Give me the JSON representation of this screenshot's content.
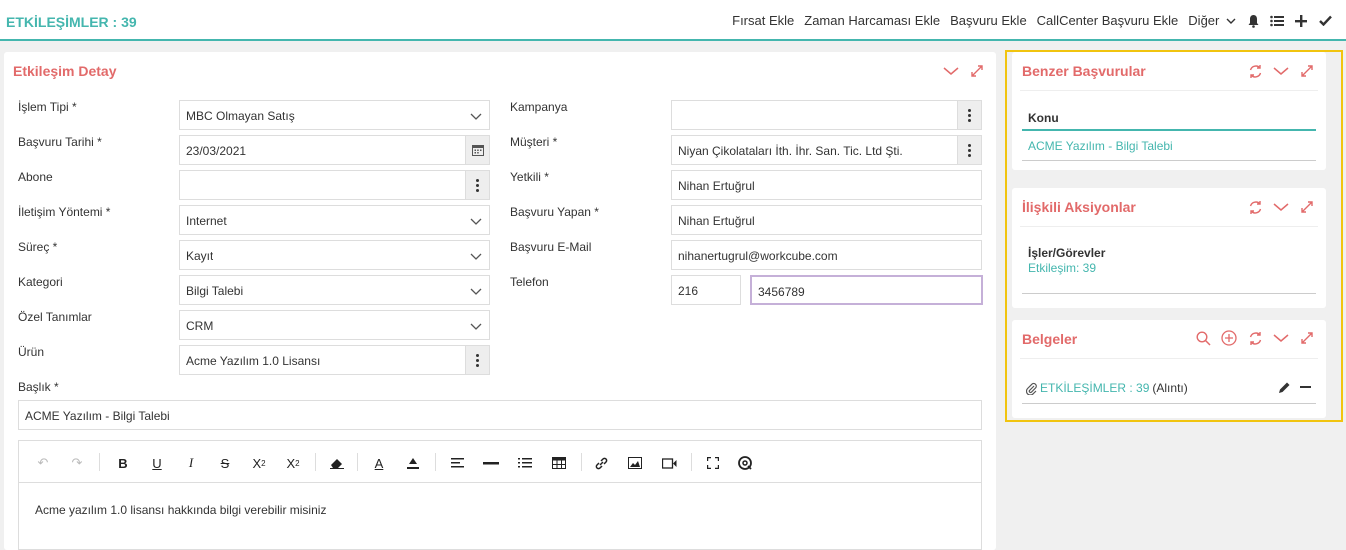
{
  "header": {
    "title": "ETKİLEŞİMLER : 39",
    "actions": [
      "Fırsat Ekle",
      "Zaman Harcaması Ekle",
      "Başvuru Ekle",
      "CallCenter Başvuru Ekle",
      "Diğer"
    ]
  },
  "main": {
    "title": "Etkileşim Detay",
    "labels": {
      "islem_tipi": "İşlem Tipi *",
      "basvuru_tarihi": "Başvuru Tarihi *",
      "abone": "Abone",
      "iletisim_yontemi": "İletişim Yöntemi *",
      "surec": "Süreç *",
      "kategori": "Kategori",
      "ozel_tanimlar": "Özel Tanımlar",
      "urun": "Ürün",
      "baslik": "Başlık *",
      "kampanya": "Kampanya",
      "musteri": "Müşteri *",
      "yetkili": "Yetkili *",
      "basvuru_yapan": "Başvuru Yapan *",
      "basvuru_email": "Başvuru E-Mail",
      "telefon": "Telefon"
    },
    "values": {
      "islem_tipi": "MBC Olmayan Satış",
      "basvuru_tarihi": "23/03/2021",
      "abone": "",
      "iletisim_yontemi": "Internet",
      "surec": "Kayıt",
      "kategori": "Bilgi Talebi",
      "ozel_tanimlar": "CRM",
      "urun": "Acme Yazılım 1.0 Lisansı",
      "baslik": "ACME Yazılım - Bilgi Talebi",
      "kampanya": "",
      "musteri": "Niyan Çikolataları İth. İhr. San. Tic. Ltd Şti.",
      "yetkili": "Nihan Ertuğrul",
      "basvuru_yapan": "Nihan Ertuğrul",
      "basvuru_email": "nihanertugrul@workcube.com",
      "telefon_kod": "216",
      "telefon_no": "3456789"
    },
    "editor_text": "Acme yazılım 1.0 lisansı hakkında bilgi verebilir misiniz"
  },
  "side": {
    "benzer": {
      "title": "Benzer Başvurular",
      "column": "Konu",
      "item": "ACME Yazılım - Bilgi Talebi"
    },
    "iliskili": {
      "title": "İlişkili Aksiyonlar",
      "heading": "İşler/Görevler",
      "item": "Etkileşim: 39"
    },
    "belgeler": {
      "title": "Belgeler",
      "doc_link": "ETKİLEŞİMLER : 39",
      "doc_suffix": "(Alıntı)"
    }
  },
  "colors": {
    "accent": "#44b6ae",
    "panel_title": "#e26a6a",
    "highlight": "#f1c40f"
  }
}
